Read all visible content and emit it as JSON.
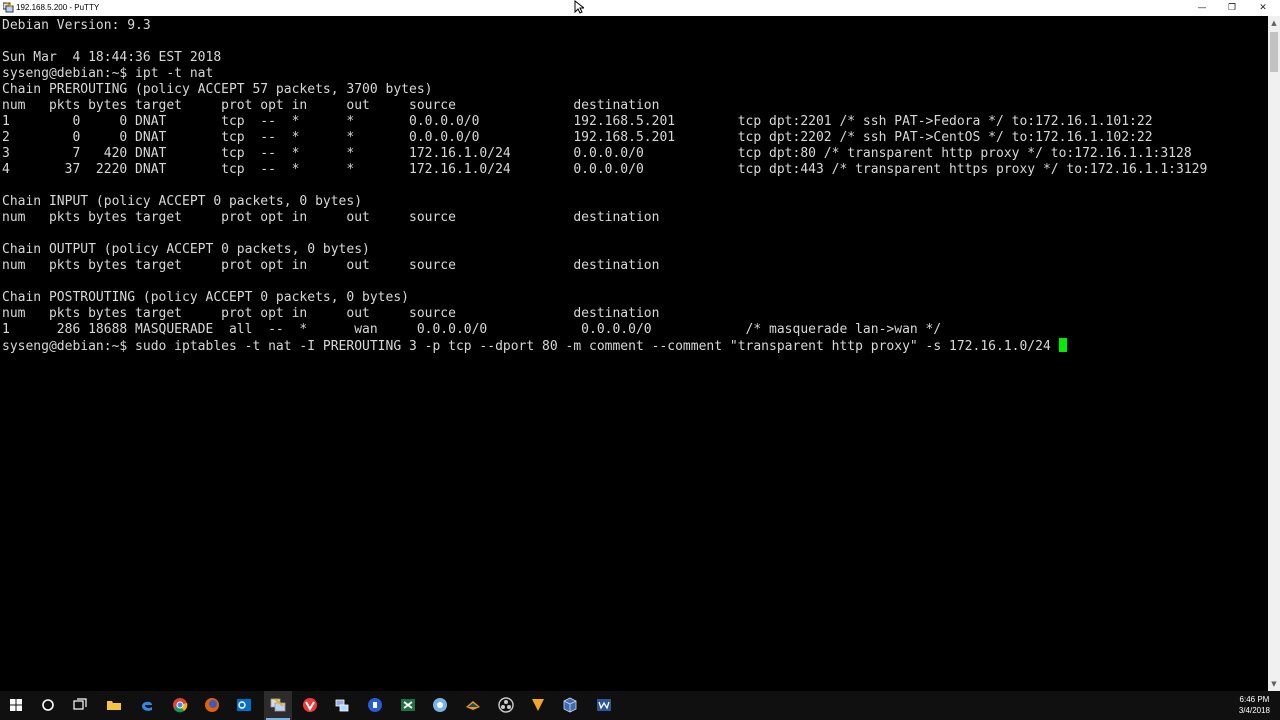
{
  "window": {
    "title": "192.168.5.200 - PuTTY",
    "minimize_glyph": "—",
    "restore_glyph": "❐",
    "close_glyph": "✕"
  },
  "terminal": {
    "background": "#000000",
    "foreground": "#d8d8d8",
    "cursor_color": "#00ee00",
    "lines": [
      "Debian Version: 9.3",
      "",
      "Sun Mar  4 18:44:36 EST 2018",
      "syseng@debian:~$ ipt -t nat",
      "Chain PREROUTING (policy ACCEPT 57 packets, 3700 bytes)",
      "num   pkts bytes target     prot opt in     out     source               destination",
      "1        0     0 DNAT       tcp  --  *      *       0.0.0.0/0            192.168.5.201        tcp dpt:2201 /* ssh PAT->Fedora */ to:172.16.1.101:22",
      "2        0     0 DNAT       tcp  --  *      *       0.0.0.0/0            192.168.5.201        tcp dpt:2202 /* ssh PAT->CentOS */ to:172.16.1.102:22",
      "3        7   420 DNAT       tcp  --  *      *       172.16.1.0/24        0.0.0.0/0            tcp dpt:80 /* transparent http proxy */ to:172.16.1.1:3128",
      "4       37  2220 DNAT       tcp  --  *      *       172.16.1.0/24        0.0.0.0/0            tcp dpt:443 /* transparent https proxy */ to:172.16.1.1:3129",
      "",
      "Chain INPUT (policy ACCEPT 0 packets, 0 bytes)",
      "num   pkts bytes target     prot opt in     out     source               destination",
      "",
      "Chain OUTPUT (policy ACCEPT 0 packets, 0 bytes)",
      "num   pkts bytes target     prot opt in     out     source               destination",
      "",
      "Chain POSTROUTING (policy ACCEPT 0 packets, 0 bytes)",
      "num   pkts bytes target     prot opt in     out     source               destination",
      "1      286 18688 MASQUERADE  all  --  *      wan     0.0.0.0/0            0.0.0.0/0            /* masquerade lan->wan */",
      "syseng@debian:~$ sudo iptables -t nat -I PREROUTING 3 -p tcp --dport 80 -m comment --comment \"transparent http proxy\" -s 172.16.1.0/24"
    ]
  },
  "scrollbar": {
    "up_glyph": "▲",
    "down_glyph": "▼"
  },
  "taskbar": {
    "icons": [
      "windows-start-icon",
      "cortana-search-icon",
      "task-view-icon",
      "file-explorer-icon",
      "edge-browser-icon",
      "chrome-icon",
      "firefox-icon",
      "outlook-icon",
      "putty-icon",
      "vivaldi-icon",
      "network-tool-icon",
      "keepass-icon",
      "excel-icon",
      "vmware-icon",
      "thunderbird-icon",
      "obs-icon",
      "vlc-icon",
      "virtualbox-icon",
      "word-icon"
    ],
    "clock_time": "6:46 PM",
    "clock_date": "3/4/2018"
  }
}
